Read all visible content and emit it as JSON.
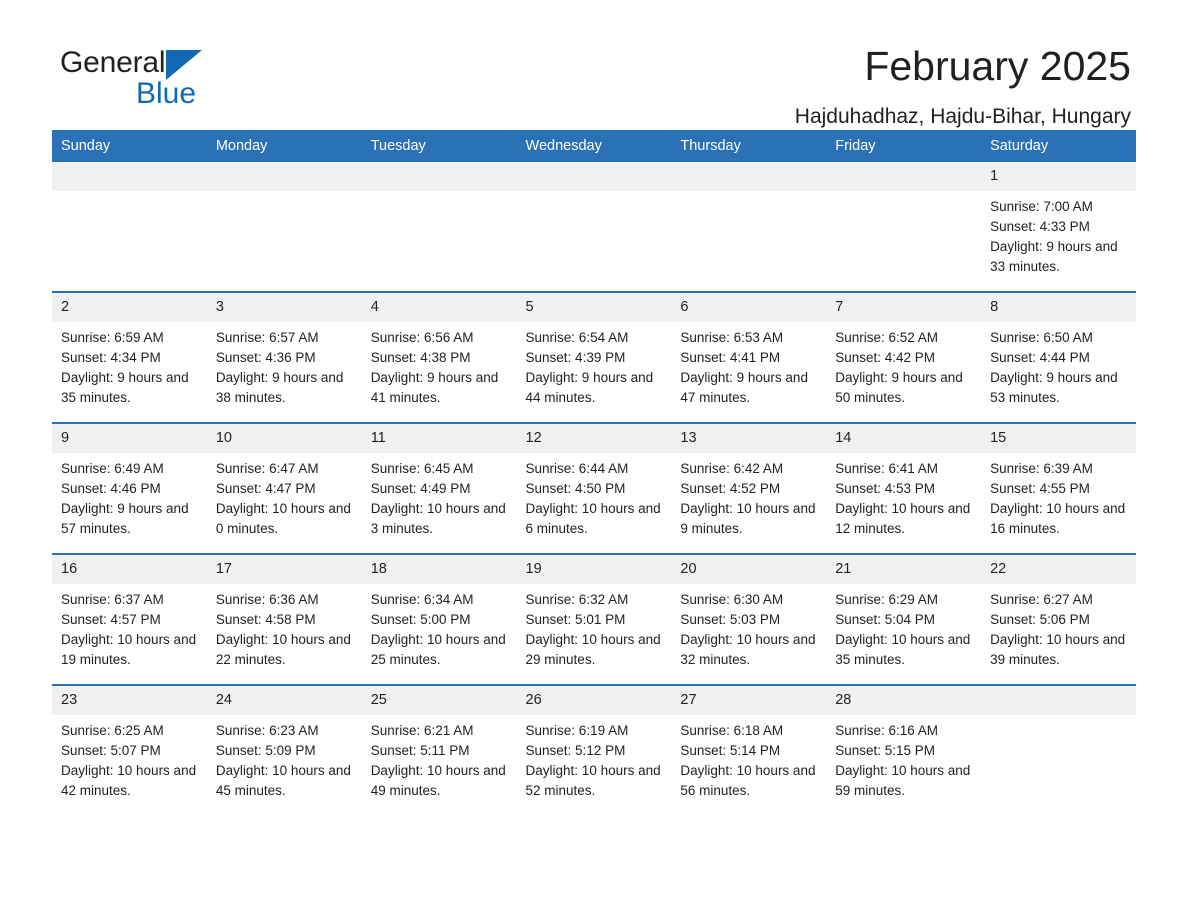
{
  "brand": {
    "word_one": "General",
    "word_two": "Blue",
    "triangle_icon": "triangle-logo-icon",
    "accent_color": "#1268b3"
  },
  "header": {
    "title": "February 2025",
    "subtitle": "Hajduhadhaz, Hajdu-Bihar, Hungary"
  },
  "calendar": {
    "header_bg": "#2a72b5",
    "daynum_bg": "#f1f1f1",
    "weekday_headers": [
      "Sunday",
      "Monday",
      "Tuesday",
      "Wednesday",
      "Thursday",
      "Friday",
      "Saturday"
    ],
    "weeks": [
      [
        {
          "day": "",
          "sunrise": "",
          "sunset": "",
          "daylight": "",
          "empty": true
        },
        {
          "day": "",
          "sunrise": "",
          "sunset": "",
          "daylight": "",
          "empty": true
        },
        {
          "day": "",
          "sunrise": "",
          "sunset": "",
          "daylight": "",
          "empty": true
        },
        {
          "day": "",
          "sunrise": "",
          "sunset": "",
          "daylight": "",
          "empty": true
        },
        {
          "day": "",
          "sunrise": "",
          "sunset": "",
          "daylight": "",
          "empty": true
        },
        {
          "day": "",
          "sunrise": "",
          "sunset": "",
          "daylight": "",
          "empty": true
        },
        {
          "day": "1",
          "sunrise": "Sunrise: 7:00 AM",
          "sunset": "Sunset: 4:33 PM",
          "daylight": "Daylight: 9 hours and 33 minutes.",
          "empty": false
        }
      ],
      [
        {
          "day": "2",
          "sunrise": "Sunrise: 6:59 AM",
          "sunset": "Sunset: 4:34 PM",
          "daylight": "Daylight: 9 hours and 35 minutes.",
          "empty": false
        },
        {
          "day": "3",
          "sunrise": "Sunrise: 6:57 AM",
          "sunset": "Sunset: 4:36 PM",
          "daylight": "Daylight: 9 hours and 38 minutes.",
          "empty": false
        },
        {
          "day": "4",
          "sunrise": "Sunrise: 6:56 AM",
          "sunset": "Sunset: 4:38 PM",
          "daylight": "Daylight: 9 hours and 41 minutes.",
          "empty": false
        },
        {
          "day": "5",
          "sunrise": "Sunrise: 6:54 AM",
          "sunset": "Sunset: 4:39 PM",
          "daylight": "Daylight: 9 hours and 44 minutes.",
          "empty": false
        },
        {
          "day": "6",
          "sunrise": "Sunrise: 6:53 AM",
          "sunset": "Sunset: 4:41 PM",
          "daylight": "Daylight: 9 hours and 47 minutes.",
          "empty": false
        },
        {
          "day": "7",
          "sunrise": "Sunrise: 6:52 AM",
          "sunset": "Sunset: 4:42 PM",
          "daylight": "Daylight: 9 hours and 50 minutes.",
          "empty": false
        },
        {
          "day": "8",
          "sunrise": "Sunrise: 6:50 AM",
          "sunset": "Sunset: 4:44 PM",
          "daylight": "Daylight: 9 hours and 53 minutes.",
          "empty": false
        }
      ],
      [
        {
          "day": "9",
          "sunrise": "Sunrise: 6:49 AM",
          "sunset": "Sunset: 4:46 PM",
          "daylight": "Daylight: 9 hours and 57 minutes.",
          "empty": false
        },
        {
          "day": "10",
          "sunrise": "Sunrise: 6:47 AM",
          "sunset": "Sunset: 4:47 PM",
          "daylight": "Daylight: 10 hours and 0 minutes.",
          "empty": false
        },
        {
          "day": "11",
          "sunrise": "Sunrise: 6:45 AM",
          "sunset": "Sunset: 4:49 PM",
          "daylight": "Daylight: 10 hours and 3 minutes.",
          "empty": false
        },
        {
          "day": "12",
          "sunrise": "Sunrise: 6:44 AM",
          "sunset": "Sunset: 4:50 PM",
          "daylight": "Daylight: 10 hours and 6 minutes.",
          "empty": false
        },
        {
          "day": "13",
          "sunrise": "Sunrise: 6:42 AM",
          "sunset": "Sunset: 4:52 PM",
          "daylight": "Daylight: 10 hours and 9 minutes.",
          "empty": false
        },
        {
          "day": "14",
          "sunrise": "Sunrise: 6:41 AM",
          "sunset": "Sunset: 4:53 PM",
          "daylight": "Daylight: 10 hours and 12 minutes.",
          "empty": false
        },
        {
          "day": "15",
          "sunrise": "Sunrise: 6:39 AM",
          "sunset": "Sunset: 4:55 PM",
          "daylight": "Daylight: 10 hours and 16 minutes.",
          "empty": false
        }
      ],
      [
        {
          "day": "16",
          "sunrise": "Sunrise: 6:37 AM",
          "sunset": "Sunset: 4:57 PM",
          "daylight": "Daylight: 10 hours and 19 minutes.",
          "empty": false
        },
        {
          "day": "17",
          "sunrise": "Sunrise: 6:36 AM",
          "sunset": "Sunset: 4:58 PM",
          "daylight": "Daylight: 10 hours and 22 minutes.",
          "empty": false
        },
        {
          "day": "18",
          "sunrise": "Sunrise: 6:34 AM",
          "sunset": "Sunset: 5:00 PM",
          "daylight": "Daylight: 10 hours and 25 minutes.",
          "empty": false
        },
        {
          "day": "19",
          "sunrise": "Sunrise: 6:32 AM",
          "sunset": "Sunset: 5:01 PM",
          "daylight": "Daylight: 10 hours and 29 minutes.",
          "empty": false
        },
        {
          "day": "20",
          "sunrise": "Sunrise: 6:30 AM",
          "sunset": "Sunset: 5:03 PM",
          "daylight": "Daylight: 10 hours and 32 minutes.",
          "empty": false
        },
        {
          "day": "21",
          "sunrise": "Sunrise: 6:29 AM",
          "sunset": "Sunset: 5:04 PM",
          "daylight": "Daylight: 10 hours and 35 minutes.",
          "empty": false
        },
        {
          "day": "22",
          "sunrise": "Sunrise: 6:27 AM",
          "sunset": "Sunset: 5:06 PM",
          "daylight": "Daylight: 10 hours and 39 minutes.",
          "empty": false
        }
      ],
      [
        {
          "day": "23",
          "sunrise": "Sunrise: 6:25 AM",
          "sunset": "Sunset: 5:07 PM",
          "daylight": "Daylight: 10 hours and 42 minutes.",
          "empty": false
        },
        {
          "day": "24",
          "sunrise": "Sunrise: 6:23 AM",
          "sunset": "Sunset: 5:09 PM",
          "daylight": "Daylight: 10 hours and 45 minutes.",
          "empty": false
        },
        {
          "day": "25",
          "sunrise": "Sunrise: 6:21 AM",
          "sunset": "Sunset: 5:11 PM",
          "daylight": "Daylight: 10 hours and 49 minutes.",
          "empty": false
        },
        {
          "day": "26",
          "sunrise": "Sunrise: 6:19 AM",
          "sunset": "Sunset: 5:12 PM",
          "daylight": "Daylight: 10 hours and 52 minutes.",
          "empty": false
        },
        {
          "day": "27",
          "sunrise": "Sunrise: 6:18 AM",
          "sunset": "Sunset: 5:14 PM",
          "daylight": "Daylight: 10 hours and 56 minutes.",
          "empty": false
        },
        {
          "day": "28",
          "sunrise": "Sunrise: 6:16 AM",
          "sunset": "Sunset: 5:15 PM",
          "daylight": "Daylight: 10 hours and 59 minutes.",
          "empty": false
        },
        {
          "day": "",
          "sunrise": "",
          "sunset": "",
          "daylight": "",
          "empty": true
        }
      ]
    ]
  }
}
